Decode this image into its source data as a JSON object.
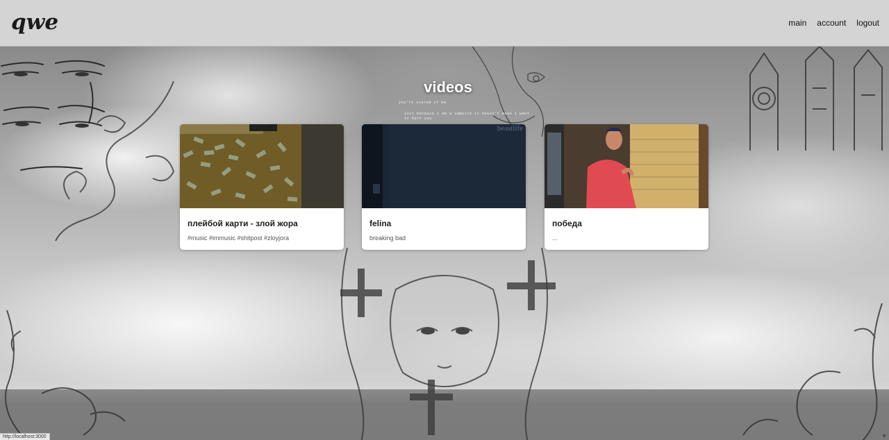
{
  "header": {
    "logo": "qwe",
    "nav": [
      "main",
      "account",
      "logout"
    ]
  },
  "main": {
    "title": "videos",
    "tagline_1": "you're scared of me",
    "tagline_2": "just because i am a vampire it doesn't mean i want",
    "tagline_3": "to hurt you"
  },
  "videos": [
    {
      "title": "плейбой карти - злой жора",
      "tags": "#music #immusic #shitpost #zloyjora"
    },
    {
      "title": "felina",
      "tags": "breaking bad",
      "watermark": "beastlife"
    },
    {
      "title": "победа",
      "tags": "..."
    }
  ],
  "status_bar": {
    "url": "http://localhost:3000"
  },
  "colors": {
    "header_bg": "#d4d4d4",
    "card_bg": "#ffffff",
    "title_text": "#ffffff"
  }
}
